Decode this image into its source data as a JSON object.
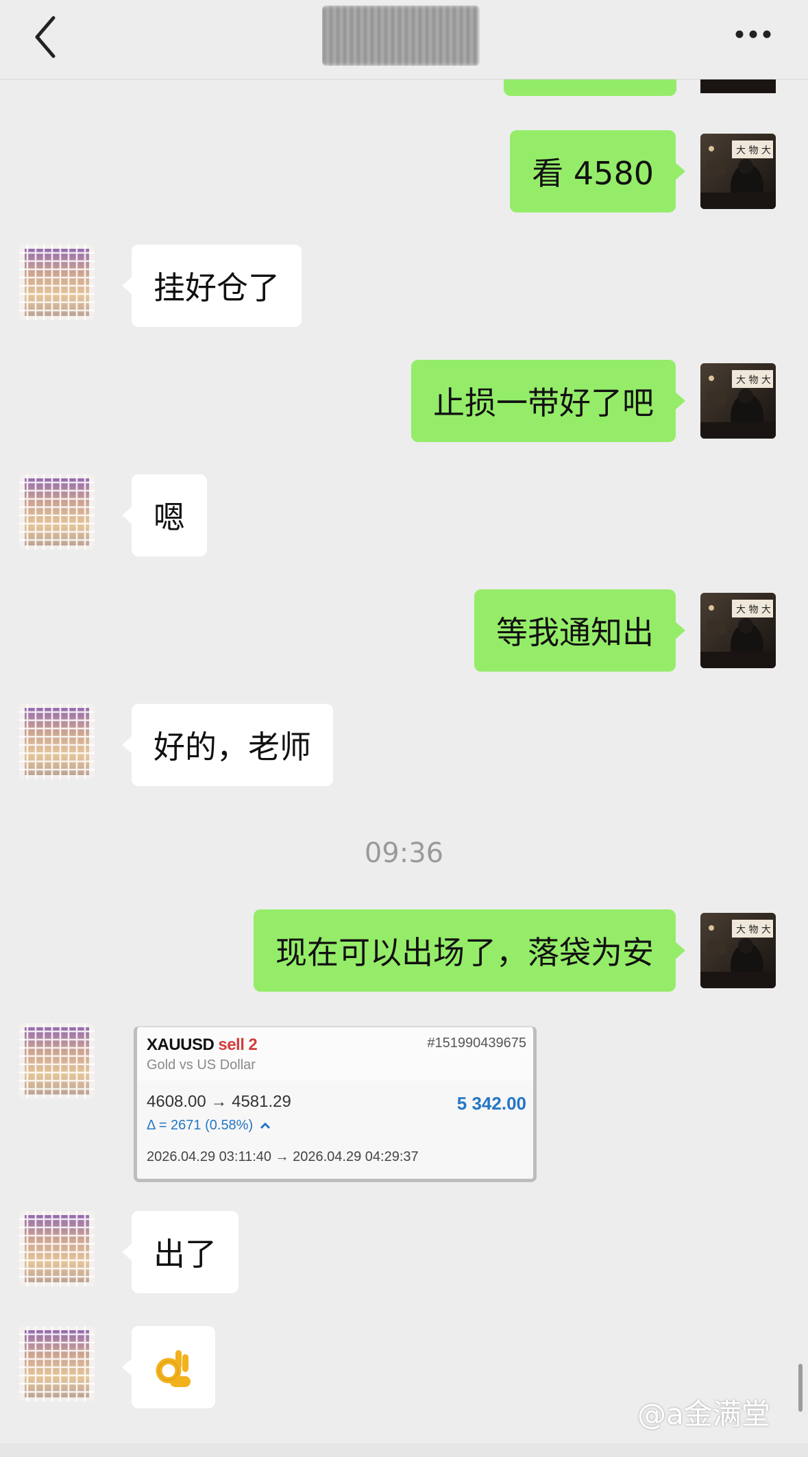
{
  "header": {
    "title": "",
    "back_icon": "chevron-left-icon",
    "more_icon": "ellipsis-icon"
  },
  "messages": [
    {
      "sender": "self",
      "text": "看 4580"
    },
    {
      "sender": "peer",
      "text": "挂好仓了"
    },
    {
      "sender": "self",
      "text": "止损一带好了吧"
    },
    {
      "sender": "peer",
      "text": "嗯"
    },
    {
      "sender": "self",
      "text": "等我通知出"
    },
    {
      "sender": "peer",
      "text": "好的，老师"
    },
    {
      "sender": "self",
      "text": "现在可以出场了，落袋为安"
    },
    {
      "sender": "peer",
      "text": "出了"
    },
    {
      "sender": "peer",
      "text": "👌"
    }
  ],
  "timestamp": "09:36",
  "trade_card": {
    "symbol": "XAUUSD",
    "side": "sell",
    "volume": "2",
    "description": "Gold vs US Dollar",
    "ticket": "#151990439675",
    "prices": "4608.00 → 4581.29",
    "profit": "5 342.00",
    "delta": "Δ = 2671 (0.58%)",
    "times": "2026.04.29 03:11:40 → 2026.04.29 04:29:37"
  },
  "watermark": "@a金满堂",
  "colors": {
    "self_bubble": "#95ec69",
    "peer_bubble": "#ffffff",
    "background": "#ededed",
    "profit_blue": "#2475c4",
    "sell_red": "#d23c3c"
  }
}
